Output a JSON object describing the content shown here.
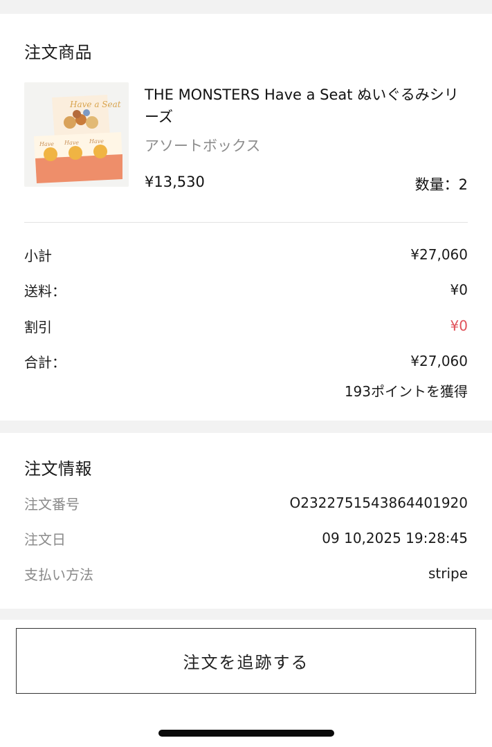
{
  "order_items": {
    "title": "注文商品",
    "product": {
      "name": "THE MONSTERS Have a Seat ぬいぐるみシリーズ",
      "variant": "アソートボックス",
      "price": "¥13,530",
      "quantity": "数量：2",
      "thumb_logo": "Have a Seat"
    }
  },
  "summary": {
    "subtotal_label": "小計",
    "subtotal_value": "¥27,060",
    "shipping_label": "送料：",
    "shipping_value": "¥0",
    "discount_label": "割引",
    "discount_value": "¥0",
    "total_label": "合計：",
    "total_value": "¥27,060",
    "points": "193ポイントを獲得"
  },
  "order_info": {
    "title": "注文情報",
    "order_number_label": "注文番号",
    "order_number_value": "O2322751543864401920",
    "order_date_label": "注文日",
    "order_date_value": "09 10,2025 19:28:45",
    "payment_label": "支払い方法",
    "payment_value": "stripe"
  },
  "actions": {
    "track_label": "注文を追跡する"
  },
  "colors": {
    "discount": "#e0525a",
    "muted": "#8a8a8a",
    "section_gap": "#f2f2f2"
  }
}
